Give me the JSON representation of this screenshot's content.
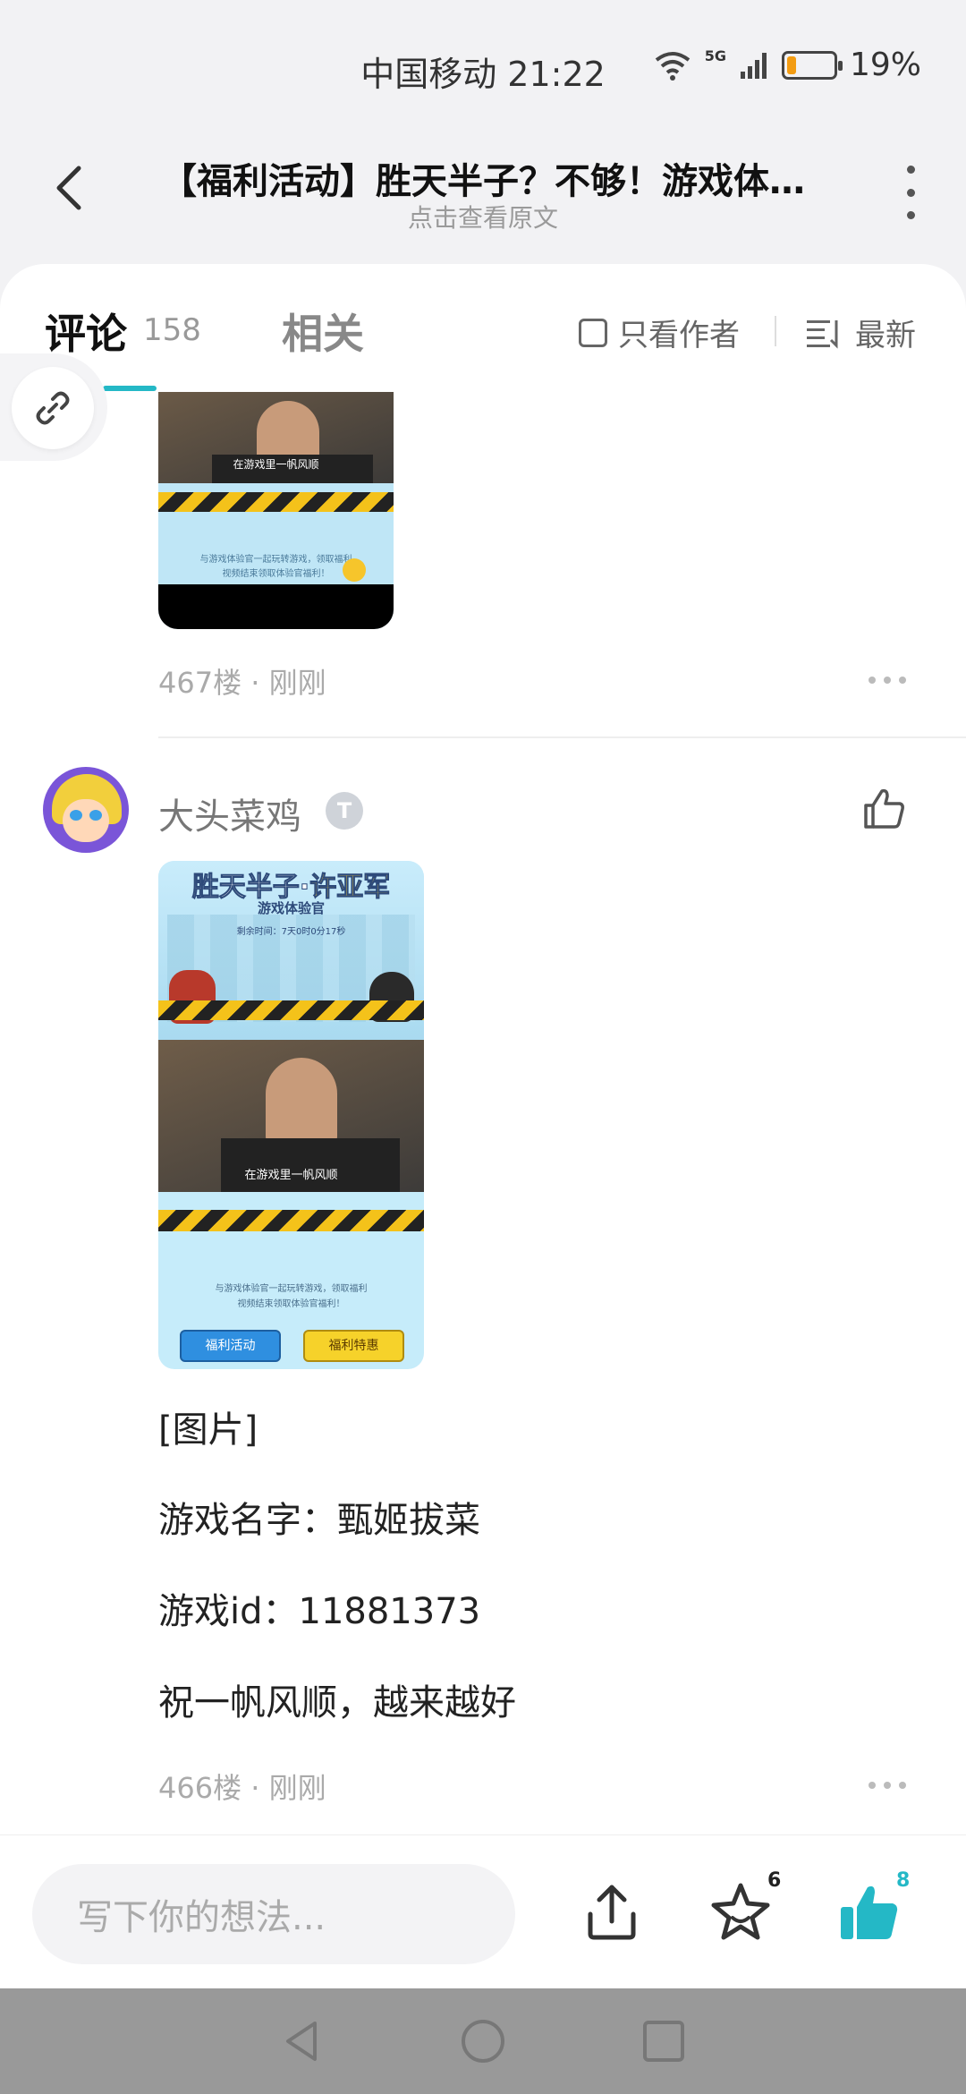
{
  "status": {
    "carrier_time": "中国移动 21:22",
    "battery": "19%",
    "battery_level": 0.19,
    "network": "5G"
  },
  "header": {
    "title": "【福利活动】胜天半子？不够！游戏体…",
    "subtitle": "点击查看原文"
  },
  "tabs": {
    "comments_label": "评论",
    "comments_count": "158",
    "related_label": "相关",
    "author_only": "只看作者",
    "sort": "最新"
  },
  "comments": [
    {
      "floor": "467楼",
      "time": "刚刚",
      "image": {
        "caption": "在游戏里一帆风顺",
        "lines": [
          "与游戏体验官一起玩转游戏，领取福利",
          "视频结束领取体验官福利！"
        ]
      }
    },
    {
      "user": "大头菜鸡",
      "badge": "T",
      "image": {
        "title_left": "胜天半子·",
        "title_right": "许亚军",
        "subtitle": "游戏体验官",
        "timer": "剩余时间：7天0时0分17秒",
        "caption": "在游戏里一帆风顺",
        "line1": "与游戏体验官一起玩转游戏，领取福利",
        "line2": "视频结束领取体验官福利！",
        "btn1": "福利活动",
        "btn2": "福利特惠"
      },
      "lines": [
        "[图片]",
        "游戏名字：甄姬拔菜",
        "游戏id：11881373",
        "祝一帆风顺，越来越好"
      ],
      "floor": "466楼",
      "time": "刚刚"
    }
  ],
  "bottom": {
    "placeholder": "写下你的想法...",
    "fav_count": "6",
    "like_count": "8"
  },
  "colors": {
    "accent": "#24b8c6",
    "battery_low": "#f39c12"
  }
}
